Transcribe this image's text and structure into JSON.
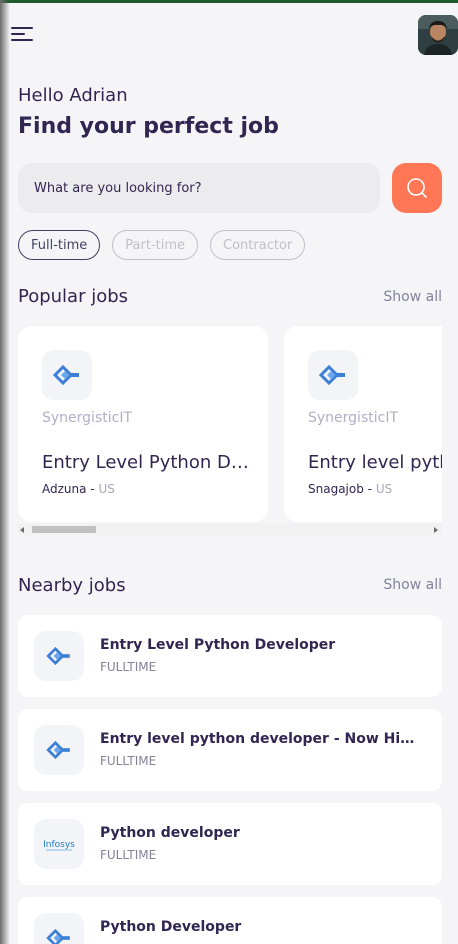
{
  "header": {
    "menu_icon": "hamburger-menu-icon",
    "avatar_icon": "user-avatar"
  },
  "welcome": {
    "greeting": "Hello Adrian",
    "headline": "Find your perfect job"
  },
  "search": {
    "placeholder": "What are you looking for?",
    "button_icon": "search-icon"
  },
  "job_types": [
    {
      "label": "Full-time",
      "active": true
    },
    {
      "label": "Part-time",
      "active": false
    },
    {
      "label": "Contractor",
      "active": false
    }
  ],
  "popular": {
    "title": "Popular jobs",
    "show_all": "Show all",
    "jobs": [
      {
        "company": "SynergisticIT",
        "title": "Entry Level Python Developer",
        "publisher": "Adzuna",
        "separator": " - ",
        "country": "US",
        "logo": "synergisticit-logo"
      },
      {
        "company": "SynergisticIT",
        "title": "Entry level python developer",
        "publisher": "Snagajob",
        "separator": " - ",
        "country": "US",
        "logo": "synergisticit-logo"
      }
    ]
  },
  "nearby": {
    "title": "Nearby jobs",
    "show_all": "Show all",
    "jobs": [
      {
        "title": "Entry Level Python Developer",
        "type": "FULLTIME",
        "logo": "synergisticit-logo"
      },
      {
        "title": "Entry level python developer - Now Hiring",
        "type": "FULLTIME",
        "logo": "synergisticit-logo"
      },
      {
        "title": "Python developer",
        "type": "FULLTIME",
        "logo": "infosys-logo",
        "logo_text": "Infosys"
      },
      {
        "title": "Python Developer",
        "type": "FULLTIME",
        "logo": "synergisticit-logo"
      }
    ]
  },
  "colors": {
    "primary": "#312651",
    "accent": "#ff7754",
    "gray": "#83829a",
    "background": "#f5f5f8"
  }
}
